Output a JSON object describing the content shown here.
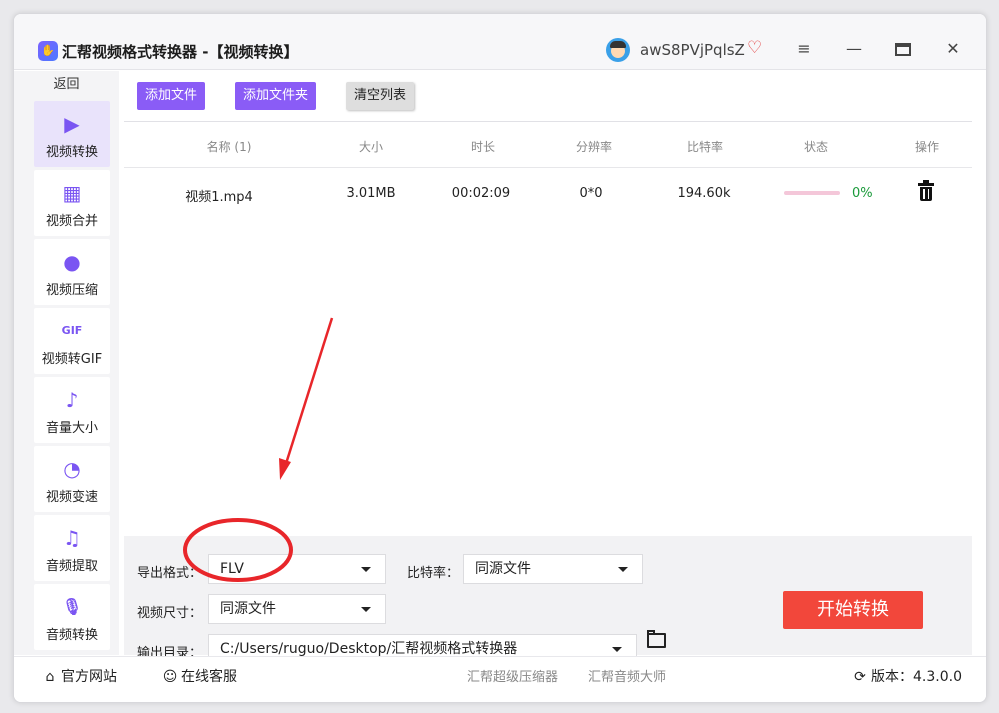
{
  "window": {
    "title": "汇帮视频格式转换器  -【视频转换】",
    "username": "awS8PVjPqlsZ",
    "controls": {
      "menu": "≡",
      "minimize": "—",
      "close": "✕"
    }
  },
  "sidebar": {
    "back": "返回",
    "items": [
      {
        "label": "视频转换",
        "icon": "▶",
        "active": true
      },
      {
        "label": "视频合并",
        "icon": "▦"
      },
      {
        "label": "视频压缩",
        "icon": "●"
      },
      {
        "label": "视频转GIF",
        "icon": "GIF"
      },
      {
        "label": "音量大小",
        "icon": "♪"
      },
      {
        "label": "视频变速",
        "icon": "◔"
      },
      {
        "label": "音频提取",
        "icon": "♫"
      },
      {
        "label": "音频转换",
        "icon": "🎙"
      }
    ]
  },
  "toolbar": {
    "add_file": "添加文件",
    "add_folder": "添加文件夹",
    "clear_list": "清空列表"
  },
  "table": {
    "headers": [
      "名称 (1)",
      "大小",
      "时长",
      "分辨率",
      "比特率",
      "状态",
      "操作"
    ],
    "rows": [
      {
        "name": "视频1.mp4",
        "size": "3.01MB",
        "duration": "00:02:09",
        "resolution": "0*0",
        "bitrate": "194.60k",
        "progress": "0%",
        "progress_value": 0
      }
    ]
  },
  "settings": {
    "format_label": "导出格式：",
    "format_value": "FLV",
    "bitrate_label": "比特率：",
    "bitrate_value": "同源文件",
    "size_label": "视频尺寸：",
    "size_value": "同源文件",
    "output_label": "输出目录：",
    "output_value": "C:/Users/ruguo/Desktop/汇帮视频格式转换器",
    "start_button": "开始转换"
  },
  "footer": {
    "website": "官方网站",
    "service": "在线客服",
    "link1": "汇帮超级压缩器",
    "link2": "汇帮音频大师",
    "version_label": "版本：",
    "version": "4.3.0.0"
  },
  "colors": {
    "accent": "#8a5cf6",
    "start_button": "#f2473b",
    "annotation": "#e8262a"
  }
}
